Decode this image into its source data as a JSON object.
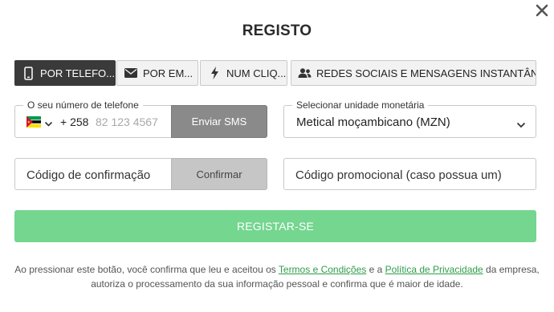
{
  "modal": {
    "title": "REGISTO"
  },
  "tabs": [
    {
      "label": "POR TELEFO...",
      "icon": "phone-icon",
      "active": true
    },
    {
      "label": "POR EM...",
      "icon": "envelope-icon",
      "active": false
    },
    {
      "label": "NUM CLIQ...",
      "icon": "lightning-icon",
      "active": false
    },
    {
      "label": "REDES SOCIAIS E MENSAGENS INSTANTÂN...",
      "icon": "users-icon",
      "active": false
    }
  ],
  "phone": {
    "legend": "O seu número de telefone",
    "flag_icon": "mozambique-flag-icon",
    "country_code": "+ 258",
    "placeholder": "82 123 4567",
    "sms_button": "Enviar SMS"
  },
  "currency": {
    "legend": "Selecionar unidade monetária",
    "value": "Metical moçambicano (MZN)"
  },
  "confirmation": {
    "placeholder": "Código de confirmação",
    "button": "Confirmar"
  },
  "promo": {
    "placeholder": "Código promocional (caso possua um)"
  },
  "register_button": "REGISTAR-SE",
  "legal": {
    "part1": "Ao pressionar este botão, você confirma que leu e aceitou os ",
    "terms_link": "Termos e Condições",
    "part2": " e a ",
    "privacy_link": "Política de Privacidade",
    "part3": " da empresa,",
    "line2": "autoriza o processamento da sua informação pessoal e confirma que é maior de idade."
  },
  "colors": {
    "active_tab": "#3a3a3a",
    "register_button": "#74d68f",
    "link": "#2e9c4a",
    "sms_button": "#8a8a8a",
    "confirm_button": "#c6c6c6"
  }
}
